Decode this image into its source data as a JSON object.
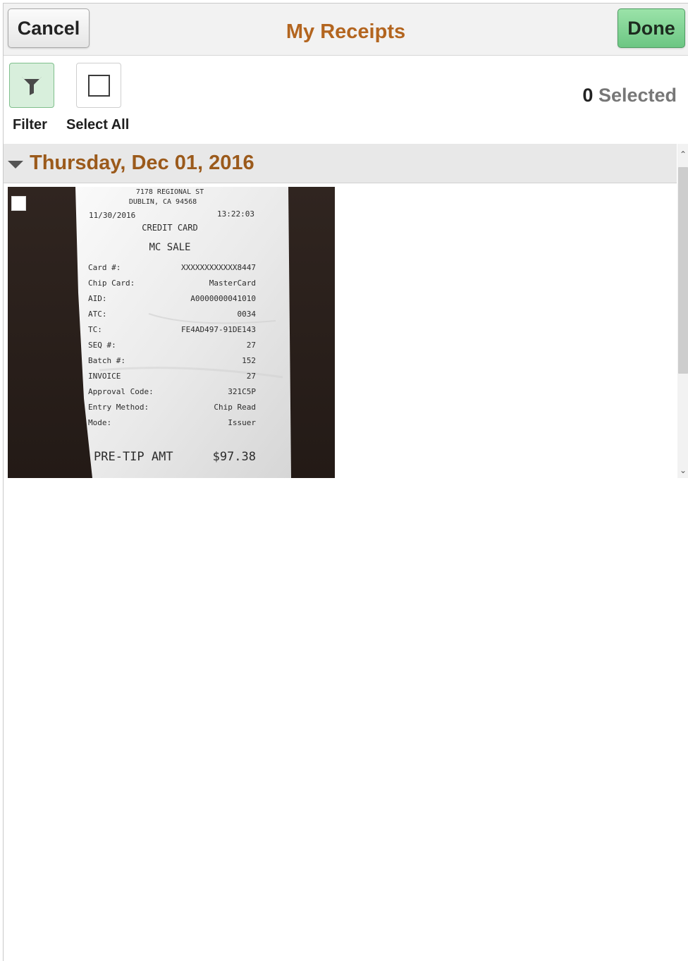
{
  "header": {
    "cancel_label": "Cancel",
    "title": "My Receipts",
    "done_label": "Done"
  },
  "toolbar": {
    "filter_label": "Filter",
    "select_all_label": "Select All",
    "selected_count": "0",
    "selected_label": "Selected",
    "filter_icon": "funnel-icon",
    "select_all_icon": "checkbox-icon"
  },
  "groups": [
    {
      "title": "Thursday, Dec 01, 2016",
      "receipts": [
        {
          "checked": false,
          "lines": {
            "address1": "7178 REGIONAL ST",
            "address2": "DUBLIN, CA 94568",
            "date": "11/30/2016",
            "time": "13:22:03",
            "type": "CREDIT CARD",
            "sale": "MC SALE",
            "rows": [
              [
                "Card #:",
                "XXXXXXXXXXXX8447"
              ],
              [
                "Chip Card:",
                "MasterCard"
              ],
              [
                "AID:",
                "A0000000041010"
              ],
              [
                "ATC:",
                "0034"
              ],
              [
                "TC:",
                "FE4AD497-91DE143"
              ],
              [
                "SEQ #:",
                "27"
              ],
              [
                "Batch #:",
                "152"
              ],
              [
                "INVOICE",
                "27"
              ],
              [
                "Approval Code:",
                "321C5P"
              ],
              [
                "Entry Method:",
                "Chip Read"
              ],
              [
                "Mode:",
                "Issuer"
              ]
            ],
            "total_label": "PRE-TIP AMT",
            "total_value": "$97.38"
          }
        }
      ]
    }
  ],
  "colors": {
    "title": "#b3651f",
    "group_title": "#9b5a1b",
    "done_button": "#6cc683",
    "filter_active": "#d8efdc"
  }
}
